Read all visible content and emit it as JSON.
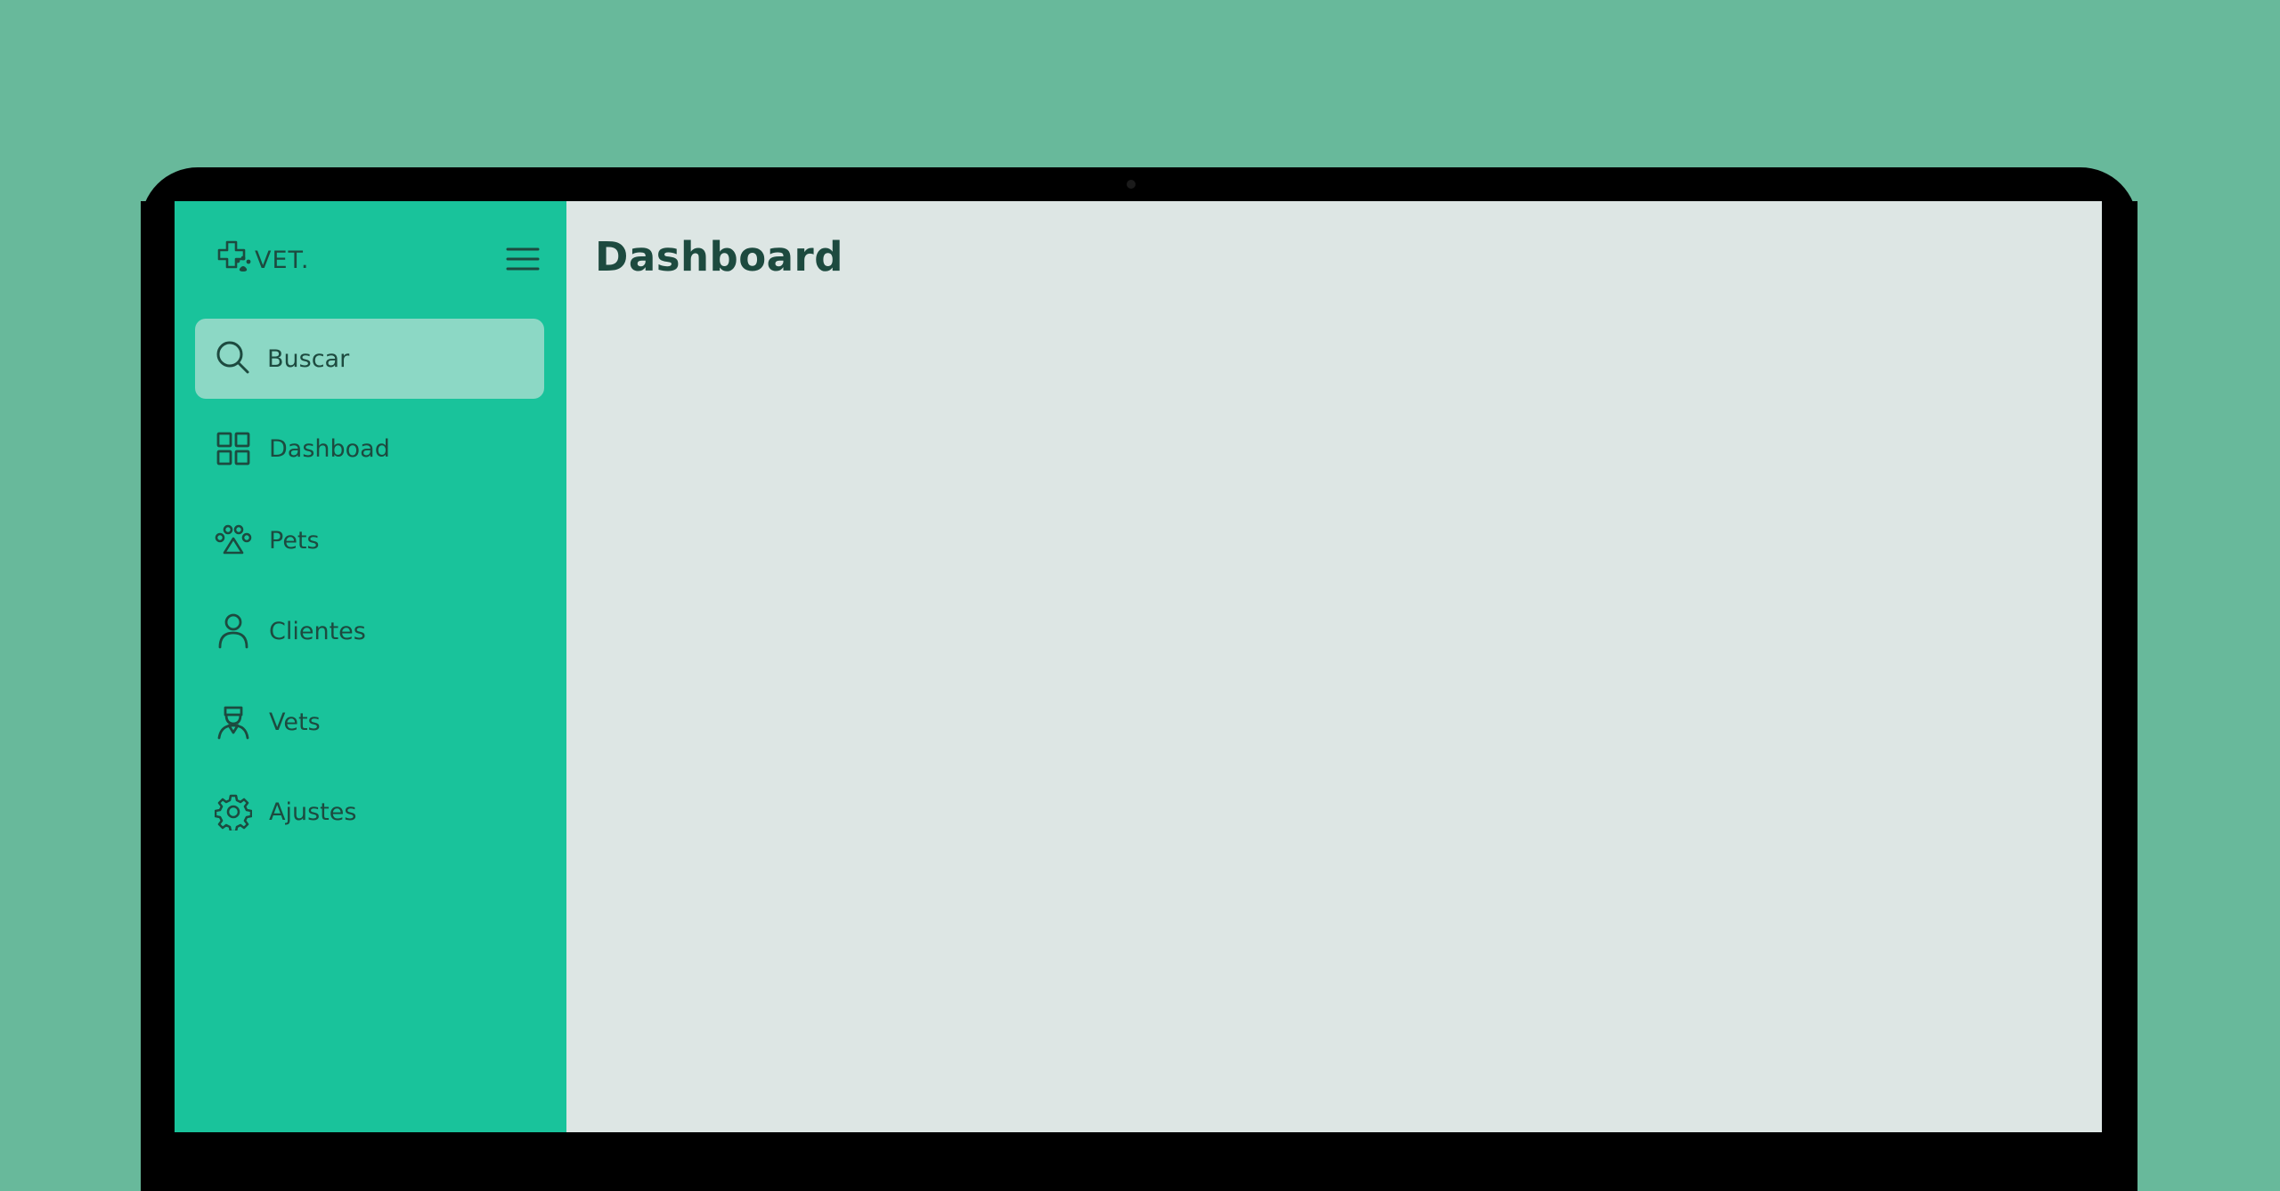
{
  "app": {
    "brand_name": "VET.",
    "brand_icon": "paw-cross-logo-icon",
    "menu_icon": "hamburger-menu-icon"
  },
  "sidebar": {
    "search": {
      "label": "Buscar",
      "icon": "search-icon"
    },
    "items": [
      {
        "label": "Dashboad",
        "icon": "grid-icon"
      },
      {
        "label": "Pets",
        "icon": "paw-icon"
      },
      {
        "label": "Clientes",
        "icon": "user-icon"
      },
      {
        "label": "Vets",
        "icon": "doctor-icon"
      },
      {
        "label": "Ajustes",
        "icon": "gear-icon"
      }
    ]
  },
  "main": {
    "title": "Dashboard"
  },
  "colors": {
    "background": "#68b99b",
    "sidebar": "#19c39b",
    "search_highlight": "#8cd8c5",
    "content": "#dde6e4",
    "text": "#1d4a3f"
  }
}
